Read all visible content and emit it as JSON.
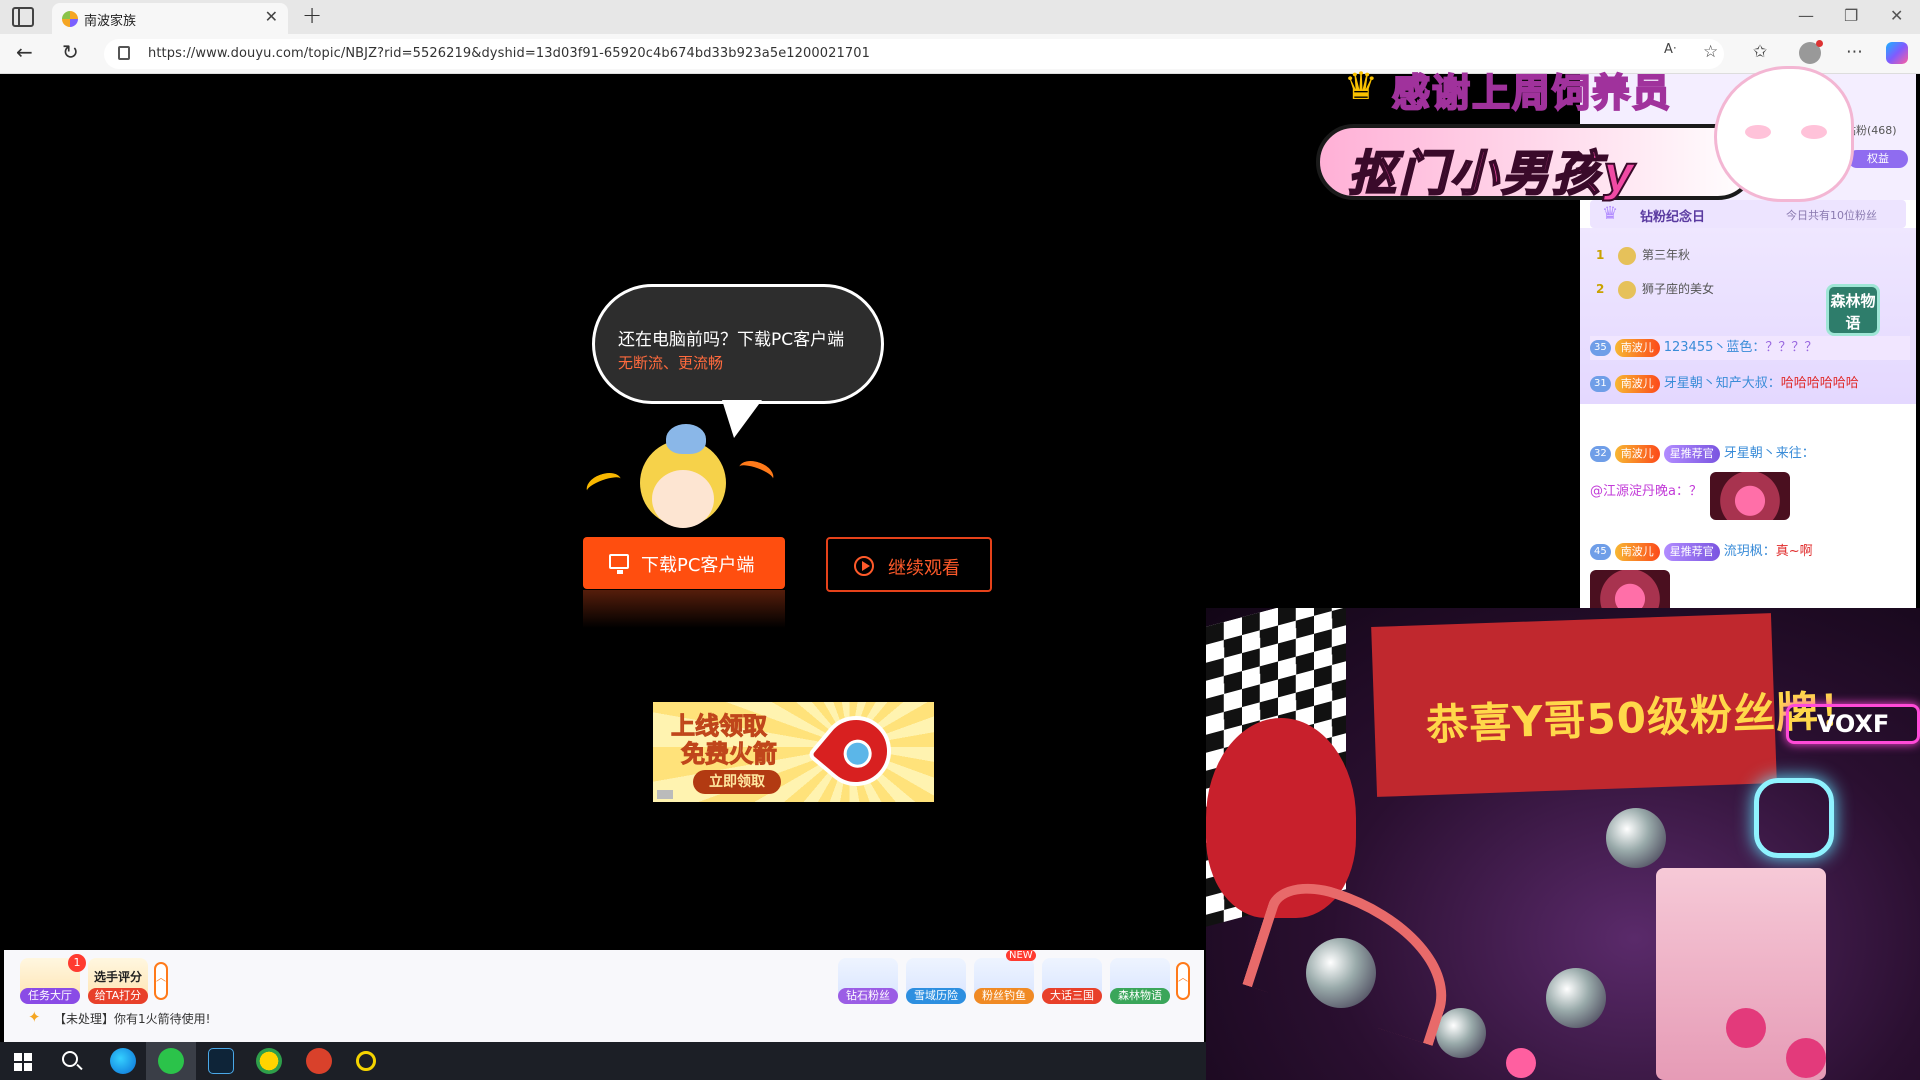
{
  "browser": {
    "tab_title": "南波家族",
    "new_tab": "+",
    "tab_close": "✕",
    "url": "https://www.douyu.com/topic/NBJZ?rid=5526219&dyshid=13d03f91-65920c4b674bd33b923a5e1200021701"
  },
  "player_overlay": {
    "cloud_line1": "还在电脑前吗？下载PC客户端",
    "cloud_line2": "无断流、更流畅",
    "download_label": "下载PC客户端",
    "continue_label": "继续观看"
  },
  "ad": {
    "line1": "上线领取",
    "line2": "免费火箭",
    "button": "立即领取"
  },
  "activity_bar": {
    "left_items": [
      {
        "label": "任务大厅",
        "badge": "1",
        "color": "#8a4be6"
      },
      {
        "label": "给TA打分",
        "heading": "选手评分",
        "color": "#e8402a"
      }
    ],
    "right_items": [
      {
        "label": "钻石粉丝",
        "color": "#9b5de5"
      },
      {
        "label": "雪域历险",
        "color": "#2d8fe0"
      },
      {
        "label": "粉丝钓鱼",
        "color": "#f08a24",
        "badge": "NEW"
      },
      {
        "label": "大话三国",
        "color": "#e8402a"
      },
      {
        "label": "森林物语",
        "color": "#3aa65a"
      }
    ],
    "notice": "【未处理】你有1火箭待使用!"
  },
  "overlay_banner": {
    "title": "感谢上周饲养员",
    "name": "抠门小男孩y"
  },
  "chat": {
    "fan_count": "钻粉(468)",
    "rights_button": "权益",
    "anniversary_title": "钻粉纪念日",
    "anniversary_note": "今日共有10位粉丝",
    "ranks": [
      {
        "num": "1",
        "name": "第三年秋"
      },
      {
        "num": "2",
        "name": "狮子座的美女"
      }
    ],
    "forest_badge": "森林物语",
    "messages": [
      {
        "level": "35",
        "fan": "南波儿",
        "user": "123455丶蓝色：",
        "text": "？？？？"
      },
      {
        "level": "31",
        "fan": "南波儿",
        "user": "牙星朝丶知产大叔：",
        "text": "哈哈哈哈哈哈"
      },
      {
        "level": "32",
        "fan": "南波儿",
        "star": "星推荐官",
        "user": "牙星朝丶来往：",
        "mention": "@江源淀丹晚a：？"
      },
      {
        "level": "45",
        "fan": "南波儿",
        "star": "星推荐官",
        "user": "流玥枫：",
        "text": "真~啊"
      }
    ]
  },
  "camera": {
    "banner_text": "恭喜Y哥50级粉丝牌！",
    "neon_sign": "VOXF"
  },
  "icons": {
    "back": "back-arrow-icon",
    "refresh": "refresh-icon",
    "read_aloud": "read-aloud-icon",
    "favorite": "star-icon"
  }
}
